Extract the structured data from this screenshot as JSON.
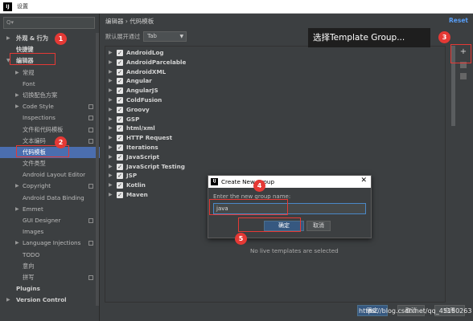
{
  "window": {
    "title": "设置",
    "app_icon": "IJ"
  },
  "sidebar": {
    "search_placeholder": "Q▾",
    "items": [
      {
        "label": "外观 & 行为",
        "arrow": "▶",
        "level": 0,
        "bold": true
      },
      {
        "label": "快捷键",
        "arrow": "",
        "level": 0,
        "bold": true
      },
      {
        "label": "编辑器",
        "arrow": "▼",
        "level": 0,
        "bold": true
      },
      {
        "label": "常规",
        "arrow": "▶",
        "level": 1
      },
      {
        "label": "Font",
        "arrow": "",
        "level": 1
      },
      {
        "label": "切换配色方案",
        "arrow": "▶",
        "level": 1
      },
      {
        "label": "Code Style",
        "arrow": "▶",
        "level": 1,
        "copy": true
      },
      {
        "label": "Inspections",
        "arrow": "",
        "level": 1,
        "copy": true
      },
      {
        "label": "文件和代码模板",
        "arrow": "",
        "level": 1,
        "copy": true
      },
      {
        "label": "文本编码",
        "arrow": "",
        "level": 1,
        "copy": true
      },
      {
        "label": "代码模板",
        "arrow": "",
        "level": 1,
        "selected": true
      },
      {
        "label": "文件类型",
        "arrow": "",
        "level": 1
      },
      {
        "label": "Android Layout Editor",
        "arrow": "",
        "level": 1
      },
      {
        "label": "Copyright",
        "arrow": "▶",
        "level": 1,
        "copy": true
      },
      {
        "label": "Android Data Binding",
        "arrow": "",
        "level": 1
      },
      {
        "label": "Emmet",
        "arrow": "▶",
        "level": 1
      },
      {
        "label": "GUI Designer",
        "arrow": "",
        "level": 1,
        "copy": true
      },
      {
        "label": "Images",
        "arrow": "",
        "level": 1
      },
      {
        "label": "Language Injections",
        "arrow": "▶",
        "level": 1,
        "copy": true
      },
      {
        "label": "TODO",
        "arrow": "",
        "level": 1
      },
      {
        "label": "意向",
        "arrow": "",
        "level": 1
      },
      {
        "label": "拼写",
        "arrow": "",
        "level": 1,
        "copy": true
      },
      {
        "label": "Plugins",
        "arrow": "",
        "level": 0,
        "bold": true
      },
      {
        "label": "Version Control",
        "arrow": "▶",
        "level": 0,
        "bold": true
      }
    ],
    "help_label": "?"
  },
  "main": {
    "breadcrumb": "编辑器  ›  代码模板",
    "reset_label": "Reset",
    "expand_label": "默认展开通过",
    "expand_value": "Tab",
    "template_groups": [
      "AndroidLog",
      "AndroidParcelable",
      "AndroidXML",
      "Angular",
      "AngularJS",
      "ColdFusion",
      "Groovy",
      "GSP",
      "html/xml",
      "HTTP Request",
      "Iterations",
      "JavaScript",
      "JavaScript Testing",
      "JSP",
      "Kotlin",
      "Maven"
    ],
    "no_templates_text": "No live templates are selected",
    "tools": {
      "add": "+",
      "add_name": "add-icon"
    }
  },
  "annotation": {
    "callout_text": "选择Template Group...",
    "badges": [
      "1",
      "2",
      "3",
      "4",
      "5"
    ],
    "color": "#e53935"
  },
  "dialog": {
    "title": "Create New Group",
    "close": "✕",
    "label": "Enter the new group name:",
    "input_value": "java",
    "ok_label": "确定",
    "cancel_label": "取消"
  },
  "footer": {
    "ok_label": "确定",
    "cancel_label": "取消",
    "apply_label": "应用",
    "watermark": "https://blog.csdn.net/qq_45150263"
  },
  "colors": {
    "accent": "#4b6eaf",
    "link": "#589df6",
    "background": "#3c3f41"
  }
}
